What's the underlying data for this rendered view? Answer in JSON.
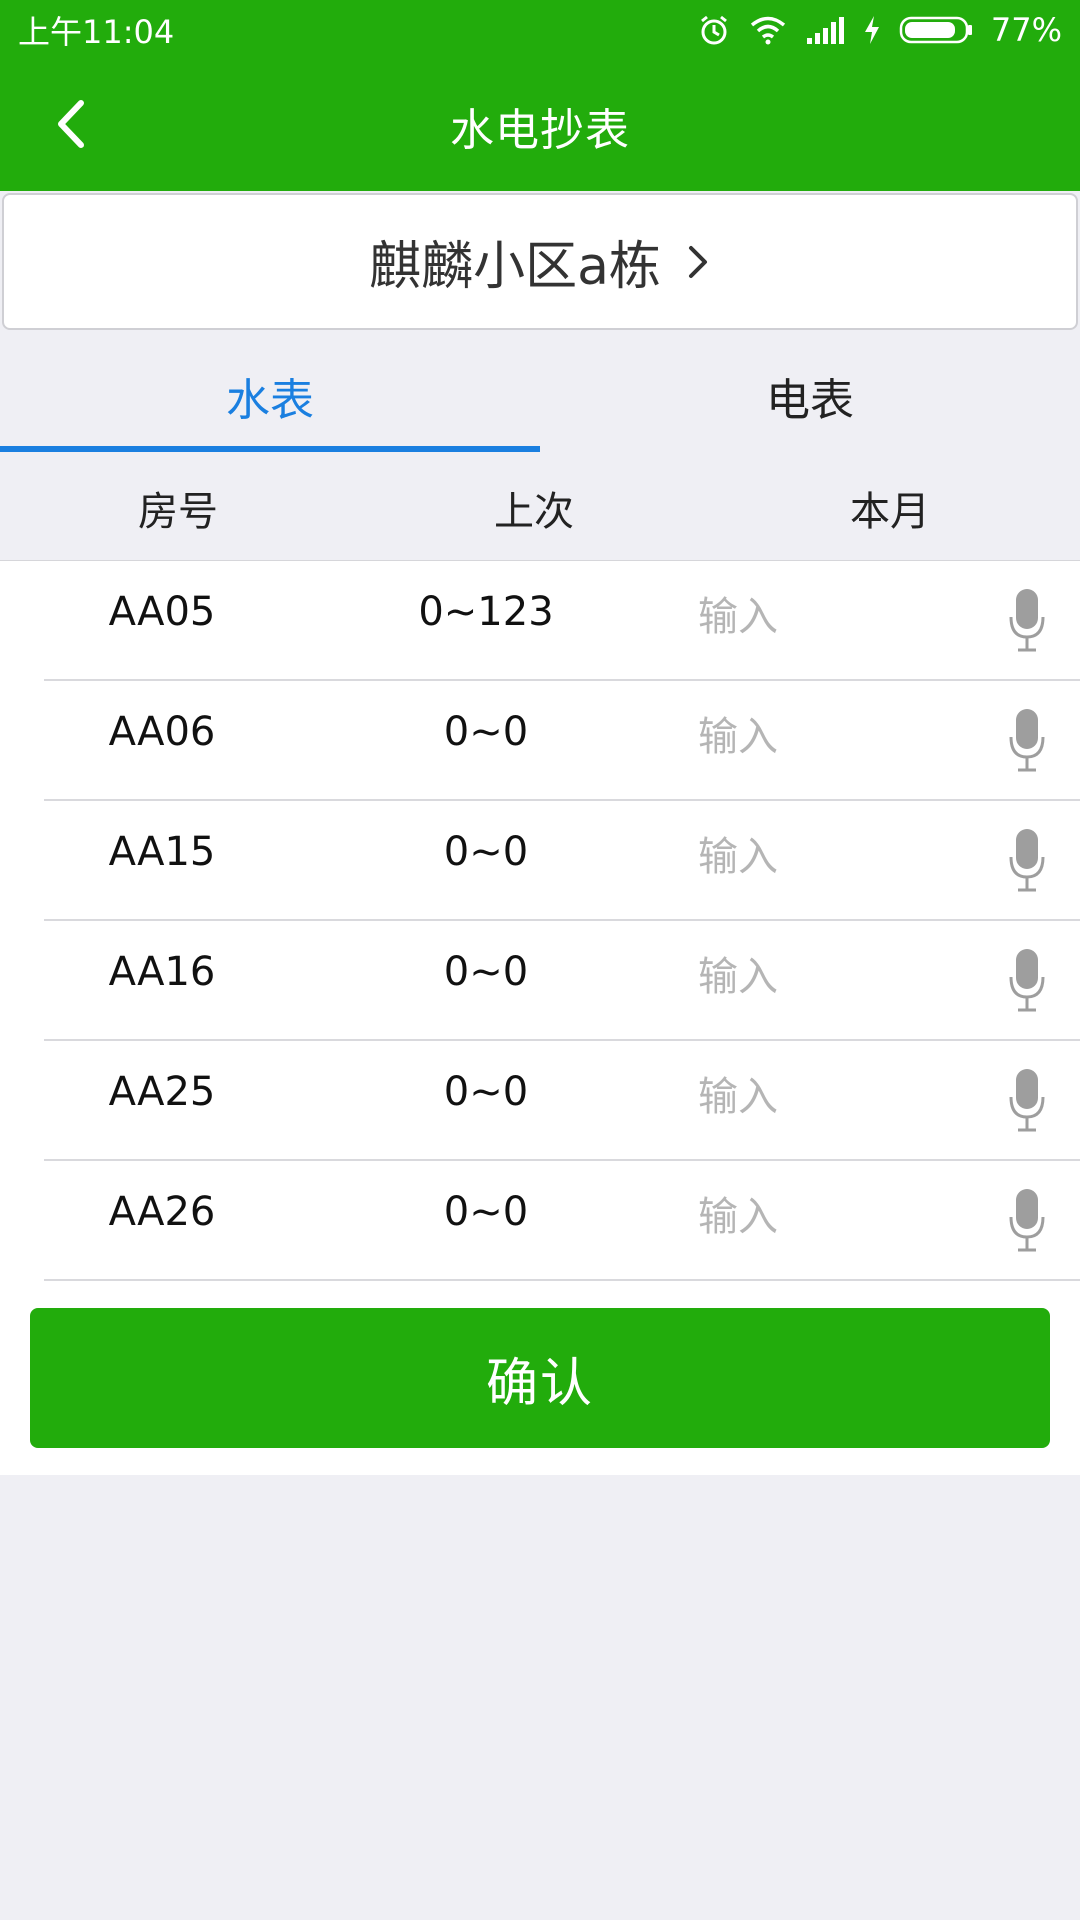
{
  "status_bar": {
    "time": "上午11:04",
    "battery": "77%",
    "icons": [
      "alarm-icon",
      "wifi-icon",
      "signal-icon",
      "charging-icon",
      "battery-icon"
    ]
  },
  "app_bar": {
    "title": "水电抄表",
    "back_icon": "chevron-left-icon"
  },
  "building": {
    "name": "麒麟小区a栋",
    "chevron_icon": "chevron-right-icon"
  },
  "tabs": [
    {
      "label": "水表",
      "active": true
    },
    {
      "label": "电表",
      "active": false
    }
  ],
  "table": {
    "headers": [
      "房号",
      "上次",
      "本月"
    ],
    "rows": [
      {
        "room": "AA05",
        "last": "0~123",
        "placeholder": "输入"
      },
      {
        "room": "AA06",
        "last": "0~0",
        "placeholder": "输入"
      },
      {
        "room": "AA15",
        "last": "0~0",
        "placeholder": "输入"
      },
      {
        "room": "AA16",
        "last": "0~0",
        "placeholder": "输入"
      },
      {
        "room": "AA25",
        "last": "0~0",
        "placeholder": "输入"
      },
      {
        "room": "AA26",
        "last": "0~0",
        "placeholder": "输入"
      }
    ]
  },
  "confirm_label": "确认",
  "colors": {
    "primary_green": "#22ac0c",
    "tab_active_blue": "#1a7fe0",
    "background": "#efeff4"
  }
}
